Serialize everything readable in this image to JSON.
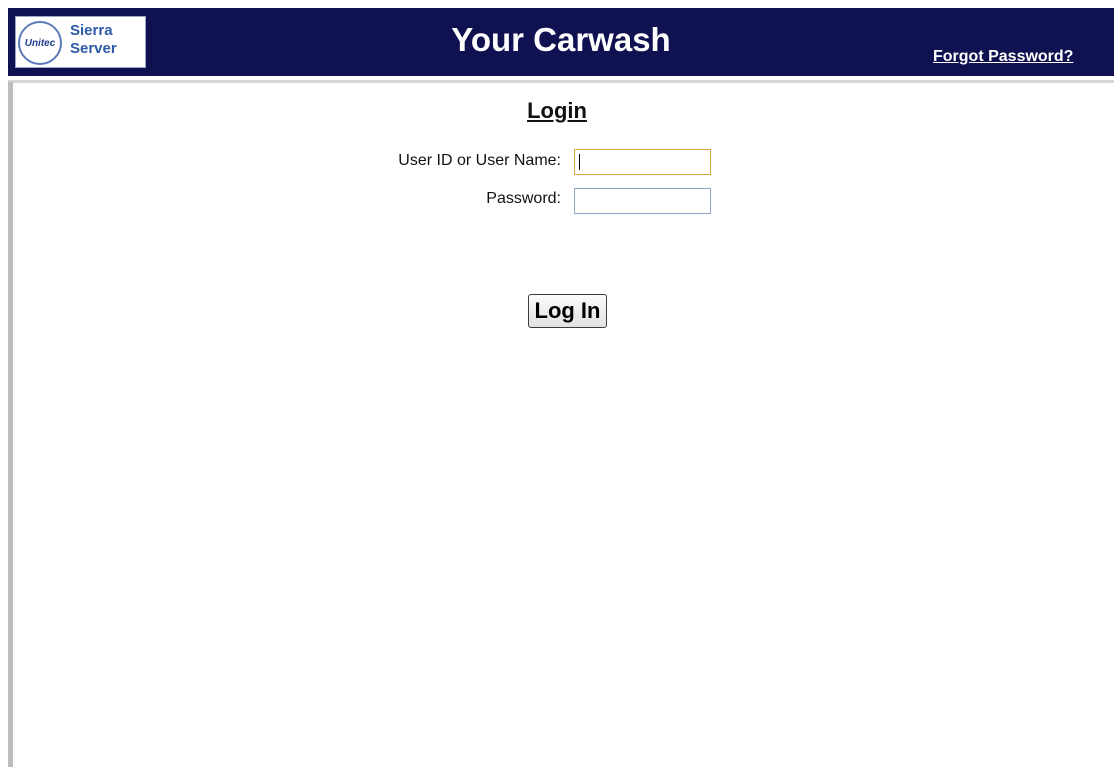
{
  "header": {
    "logo": {
      "seal_text": "Unitec",
      "name_line1": "Sierra",
      "name_line2": "Server"
    },
    "title": "Your Carwash",
    "forgot_password_link": "Forgot Password?"
  },
  "login": {
    "title": "Login",
    "user_label": "User ID or User Name:",
    "user_value": "",
    "password_label": "Password:",
    "password_value": "",
    "submit_label": "Log In"
  },
  "colors": {
    "header_background": "#0f1150",
    "header_text": "#ffffff",
    "focused_input_border": "#d9a744",
    "input_border": "#8fa6c4"
  }
}
